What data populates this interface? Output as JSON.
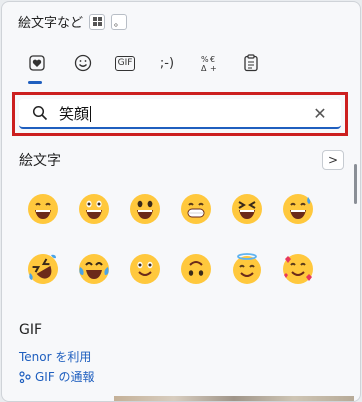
{
  "titlebar": {
    "title": "絵文字など",
    "small_btn_label": "。"
  },
  "tabs": [
    {
      "name": "tab-emoji",
      "label": ""
    },
    {
      "name": "tab-kaomoji-face",
      "label": ""
    },
    {
      "name": "tab-gif",
      "label": "GIF"
    },
    {
      "name": "tab-kaomoji",
      "label": ";-)"
    },
    {
      "name": "tab-symbols",
      "label": "%    "
    },
    {
      "name": "tab-clipboard",
      "label": ""
    }
  ],
  "search": {
    "value": "笑顔"
  },
  "emoji_section": {
    "title": "絵文字",
    "next_label": ">"
  },
  "emojis": [
    "grinning-face",
    "grinning-face-big-eyes",
    "beaming-face",
    "grimacing-smile",
    "squinting-face",
    "grinning-sweat",
    "rolling-laughing",
    "tears-of-joy",
    "slightly-smiling",
    "upside-down-face",
    "smiling-halo",
    "smiling-hearts"
  ],
  "gif_section": {
    "title": "GIF",
    "tenor_link": "Tenor を利用",
    "report_link": "GIF の通報"
  },
  "colors": {
    "accent": "#1f5fbf",
    "highlight": "#cc1f1f",
    "emoji_yellow": "#ffc83d"
  }
}
